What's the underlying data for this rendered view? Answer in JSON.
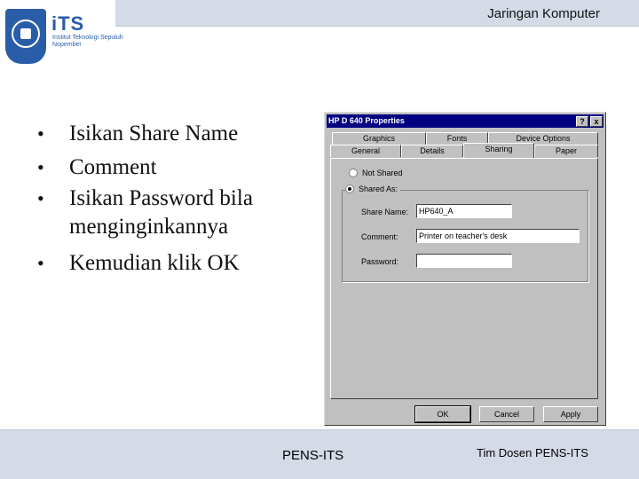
{
  "header": {
    "title": "Jaringan Komputer",
    "logo": {
      "name": "iTS",
      "subtitle": "Institut Teknologi Sepuluh Nopember"
    }
  },
  "bullets": [
    "Isikan Share Name",
    "Comment",
    "Isikan Password bila menginginkannya",
    "Kemudian klik OK"
  ],
  "dialog": {
    "title": "HP D 640 Properties",
    "help_label": "?",
    "close_label": "x",
    "tabs": {
      "graphics": "Graphics",
      "fonts": "Fonts",
      "device_options": "Device Options",
      "general": "General",
      "details": "Details",
      "sharing": "Sharing",
      "paper": "Paper"
    },
    "not_shared_label": "Not Shared",
    "shared_as_label": "Shared As:",
    "share_name_label": "Share Name:",
    "share_name_value": "HP640_A",
    "comment_label": "Comment:",
    "comment_value": "Printer on teacher's desk",
    "password_label": "Password:",
    "password_value": "",
    "ok_label": "OK",
    "cancel_label": "Cancel",
    "apply_label": "Apply"
  },
  "footer": {
    "center": "PENS-ITS",
    "right": "Tim Dosen PENS-ITS"
  },
  "colors": {
    "header_bar": "#d4dae6",
    "titlebar": "#000080",
    "window_face": "#c0c0c0",
    "logo_blue": "#2a5da8"
  }
}
